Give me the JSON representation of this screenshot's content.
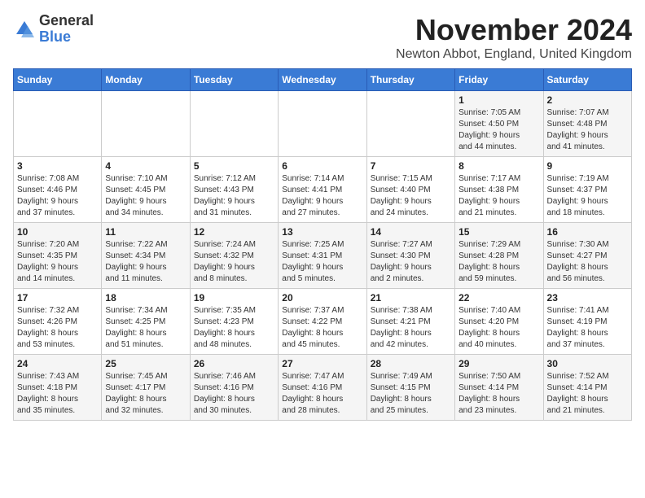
{
  "logo": {
    "general": "General",
    "blue": "Blue"
  },
  "title": "November 2024",
  "location": "Newton Abbot, England, United Kingdom",
  "headers": [
    "Sunday",
    "Monday",
    "Tuesday",
    "Wednesday",
    "Thursday",
    "Friday",
    "Saturday"
  ],
  "weeks": [
    [
      {
        "day": "",
        "info": ""
      },
      {
        "day": "",
        "info": ""
      },
      {
        "day": "",
        "info": ""
      },
      {
        "day": "",
        "info": ""
      },
      {
        "day": "",
        "info": ""
      },
      {
        "day": "1",
        "info": "Sunrise: 7:05 AM\nSunset: 4:50 PM\nDaylight: 9 hours\nand 44 minutes."
      },
      {
        "day": "2",
        "info": "Sunrise: 7:07 AM\nSunset: 4:48 PM\nDaylight: 9 hours\nand 41 minutes."
      }
    ],
    [
      {
        "day": "3",
        "info": "Sunrise: 7:08 AM\nSunset: 4:46 PM\nDaylight: 9 hours\nand 37 minutes."
      },
      {
        "day": "4",
        "info": "Sunrise: 7:10 AM\nSunset: 4:45 PM\nDaylight: 9 hours\nand 34 minutes."
      },
      {
        "day": "5",
        "info": "Sunrise: 7:12 AM\nSunset: 4:43 PM\nDaylight: 9 hours\nand 31 minutes."
      },
      {
        "day": "6",
        "info": "Sunrise: 7:14 AM\nSunset: 4:41 PM\nDaylight: 9 hours\nand 27 minutes."
      },
      {
        "day": "7",
        "info": "Sunrise: 7:15 AM\nSunset: 4:40 PM\nDaylight: 9 hours\nand 24 minutes."
      },
      {
        "day": "8",
        "info": "Sunrise: 7:17 AM\nSunset: 4:38 PM\nDaylight: 9 hours\nand 21 minutes."
      },
      {
        "day": "9",
        "info": "Sunrise: 7:19 AM\nSunset: 4:37 PM\nDaylight: 9 hours\nand 18 minutes."
      }
    ],
    [
      {
        "day": "10",
        "info": "Sunrise: 7:20 AM\nSunset: 4:35 PM\nDaylight: 9 hours\nand 14 minutes."
      },
      {
        "day": "11",
        "info": "Sunrise: 7:22 AM\nSunset: 4:34 PM\nDaylight: 9 hours\nand 11 minutes."
      },
      {
        "day": "12",
        "info": "Sunrise: 7:24 AM\nSunset: 4:32 PM\nDaylight: 9 hours\nand 8 minutes."
      },
      {
        "day": "13",
        "info": "Sunrise: 7:25 AM\nSunset: 4:31 PM\nDaylight: 9 hours\nand 5 minutes."
      },
      {
        "day": "14",
        "info": "Sunrise: 7:27 AM\nSunset: 4:30 PM\nDaylight: 9 hours\nand 2 minutes."
      },
      {
        "day": "15",
        "info": "Sunrise: 7:29 AM\nSunset: 4:28 PM\nDaylight: 8 hours\nand 59 minutes."
      },
      {
        "day": "16",
        "info": "Sunrise: 7:30 AM\nSunset: 4:27 PM\nDaylight: 8 hours\nand 56 minutes."
      }
    ],
    [
      {
        "day": "17",
        "info": "Sunrise: 7:32 AM\nSunset: 4:26 PM\nDaylight: 8 hours\nand 53 minutes."
      },
      {
        "day": "18",
        "info": "Sunrise: 7:34 AM\nSunset: 4:25 PM\nDaylight: 8 hours\nand 51 minutes."
      },
      {
        "day": "19",
        "info": "Sunrise: 7:35 AM\nSunset: 4:23 PM\nDaylight: 8 hours\nand 48 minutes."
      },
      {
        "day": "20",
        "info": "Sunrise: 7:37 AM\nSunset: 4:22 PM\nDaylight: 8 hours\nand 45 minutes."
      },
      {
        "day": "21",
        "info": "Sunrise: 7:38 AM\nSunset: 4:21 PM\nDaylight: 8 hours\nand 42 minutes."
      },
      {
        "day": "22",
        "info": "Sunrise: 7:40 AM\nSunset: 4:20 PM\nDaylight: 8 hours\nand 40 minutes."
      },
      {
        "day": "23",
        "info": "Sunrise: 7:41 AM\nSunset: 4:19 PM\nDaylight: 8 hours\nand 37 minutes."
      }
    ],
    [
      {
        "day": "24",
        "info": "Sunrise: 7:43 AM\nSunset: 4:18 PM\nDaylight: 8 hours\nand 35 minutes."
      },
      {
        "day": "25",
        "info": "Sunrise: 7:45 AM\nSunset: 4:17 PM\nDaylight: 8 hours\nand 32 minutes."
      },
      {
        "day": "26",
        "info": "Sunrise: 7:46 AM\nSunset: 4:16 PM\nDaylight: 8 hours\nand 30 minutes."
      },
      {
        "day": "27",
        "info": "Sunrise: 7:47 AM\nSunset: 4:16 PM\nDaylight: 8 hours\nand 28 minutes."
      },
      {
        "day": "28",
        "info": "Sunrise: 7:49 AM\nSunset: 4:15 PM\nDaylight: 8 hours\nand 25 minutes."
      },
      {
        "day": "29",
        "info": "Sunrise: 7:50 AM\nSunset: 4:14 PM\nDaylight: 8 hours\nand 23 minutes."
      },
      {
        "day": "30",
        "info": "Sunrise: 7:52 AM\nSunset: 4:14 PM\nDaylight: 8 hours\nand 21 minutes."
      }
    ]
  ]
}
